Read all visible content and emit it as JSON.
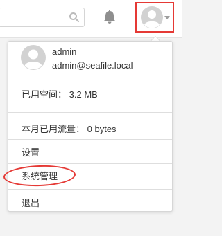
{
  "header": {
    "search_icon": "search-icon",
    "notification_icon": "bell-icon",
    "avatar_icon": "user-avatar-icon",
    "caret_icon": "caret-down-icon"
  },
  "user_menu": {
    "username": "admin",
    "email": "admin@seafile.local",
    "storage": {
      "label": "已用空间：",
      "value": "3.2 MB"
    },
    "traffic": {
      "label": "本月已用流量：",
      "value": "0 bytes"
    },
    "items": [
      {
        "label": "设置"
      },
      {
        "label": "系统管理"
      },
      {
        "label": "退出"
      }
    ]
  },
  "colors": {
    "highlight": "#e53935",
    "icon_gray": "#9e9e9e"
  }
}
